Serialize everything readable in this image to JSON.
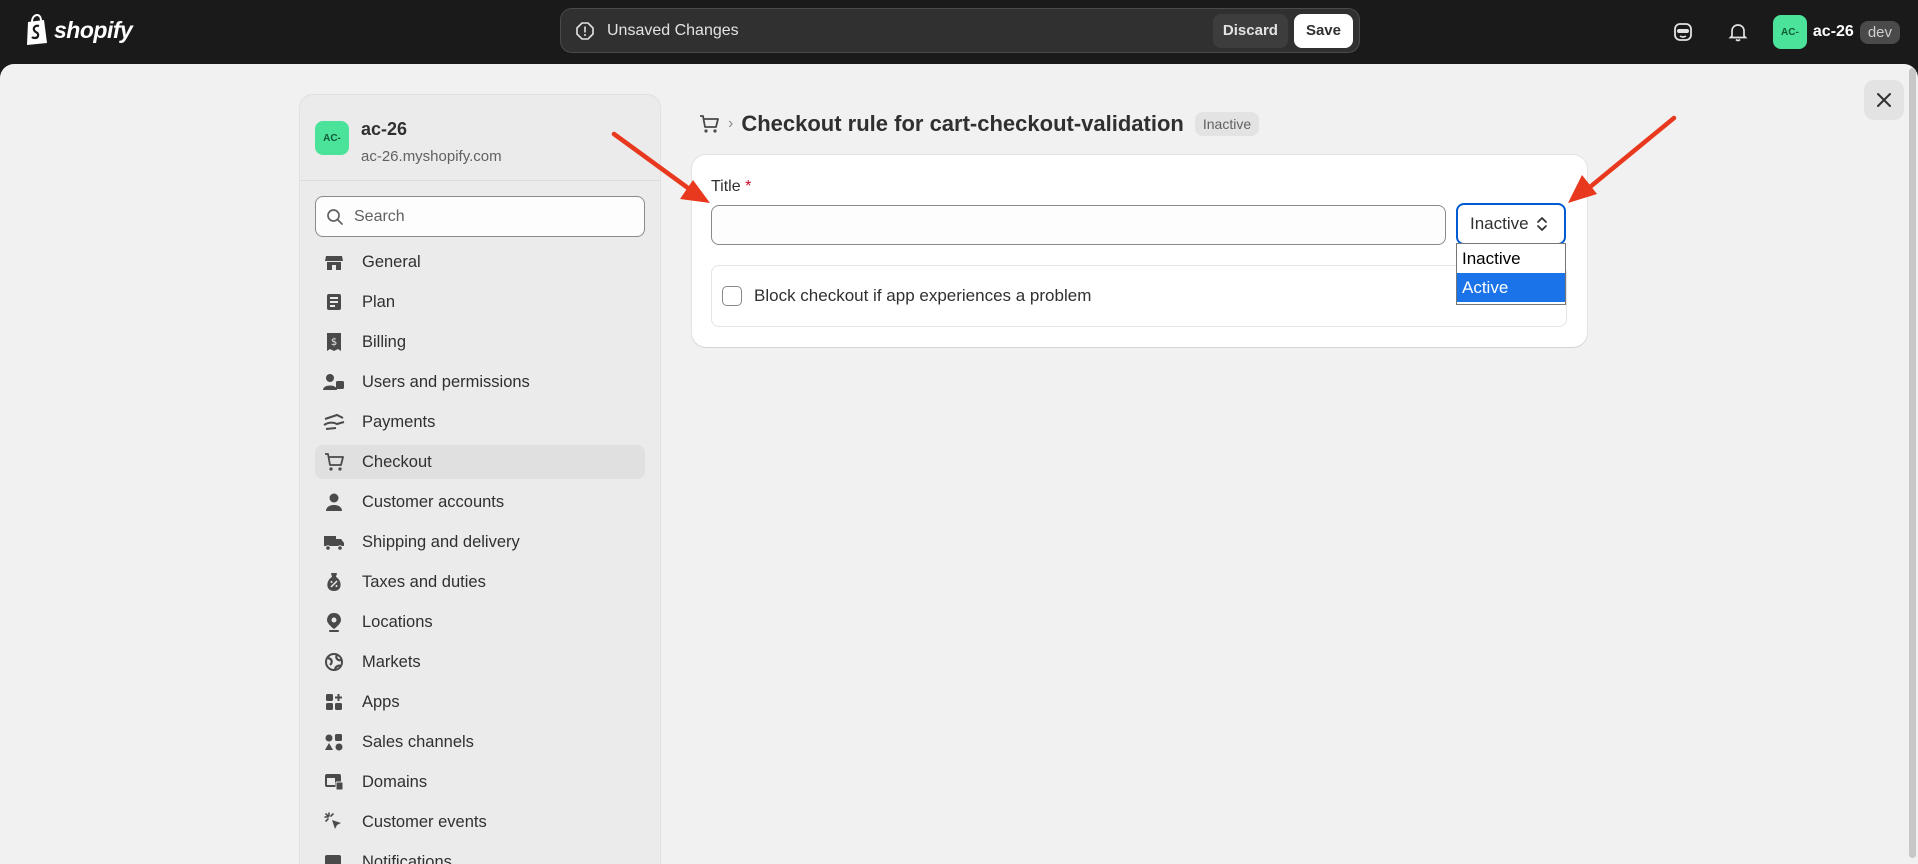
{
  "topbar": {
    "logo_text": "shopify",
    "savebar_message": "Unsaved Changes",
    "discard_label": "Discard",
    "save_label": "Save",
    "store_avatar": "AC-",
    "store_name": "ac-26",
    "env_badge": "dev",
    "icons": [
      "shopify-bag-icon",
      "warning-icon",
      "sidekick-icon",
      "bell-icon"
    ]
  },
  "sidebar": {
    "avatar": "AC-",
    "store_title": "ac-26",
    "store_url": "ac-26.myshopify.com",
    "search_placeholder": "Search",
    "items": [
      {
        "label": "General",
        "icon": "store-icon"
      },
      {
        "label": "Plan",
        "icon": "plan-icon"
      },
      {
        "label": "Billing",
        "icon": "receipt-icon"
      },
      {
        "label": "Users and permissions",
        "icon": "users-icon"
      },
      {
        "label": "Payments",
        "icon": "hand-card-icon"
      },
      {
        "label": "Checkout",
        "icon": "cart-icon",
        "active": true
      },
      {
        "label": "Customer accounts",
        "icon": "person-icon"
      },
      {
        "label": "Shipping and delivery",
        "icon": "truck-icon"
      },
      {
        "label": "Taxes and duties",
        "icon": "tax-icon"
      },
      {
        "label": "Locations",
        "icon": "location-icon"
      },
      {
        "label": "Markets",
        "icon": "globe-icon"
      },
      {
        "label": "Apps",
        "icon": "apps-icon"
      },
      {
        "label": "Sales channels",
        "icon": "channels-icon"
      },
      {
        "label": "Domains",
        "icon": "domain-icon"
      },
      {
        "label": "Customer events",
        "icon": "cursor-icon"
      },
      {
        "label": "Notifications",
        "icon": "notification-icon"
      }
    ]
  },
  "main": {
    "page_title": "Checkout rule for cart-checkout-validation",
    "status_badge": "Inactive",
    "title_label": "Title",
    "required_mark": "*",
    "title_value": "",
    "status_select": {
      "selected": "Inactive",
      "options": [
        "Inactive",
        "Active"
      ],
      "highlighted": "Active"
    },
    "block_checkout_label": "Block checkout if app experiences a problem",
    "block_checkout_checked": false
  },
  "colors": {
    "topbar_bg": "#1a1a1a",
    "page_bg": "#f1f1f1",
    "avatar_green": "#4be39a",
    "focus_blue": "#005bd3",
    "highlight_blue": "#1a73e8",
    "annotation_red": "#e8391f"
  }
}
